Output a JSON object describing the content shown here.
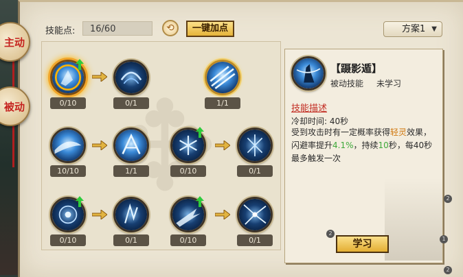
{
  "side_tabs": {
    "active": "主动",
    "passive": "被动"
  },
  "header": {
    "skill_points_label": "技能点:",
    "skill_points_value": "16/60",
    "one_key_button": "一键加点",
    "plan_select_value": "方案1"
  },
  "tree": {
    "skills": [
      {
        "level": "0/10"
      },
      {
        "level": "0/1"
      },
      {
        "level": "1/1"
      },
      {
        "level": "10/10"
      },
      {
        "level": "1/1"
      },
      {
        "level": "0/10"
      },
      {
        "level": "0/1"
      },
      {
        "level": "0/10"
      },
      {
        "level": "0/1"
      },
      {
        "level": "0/10"
      },
      {
        "level": "0/1"
      }
    ]
  },
  "detail": {
    "name": "【蹑影遁】",
    "type": "被动技能",
    "status": "未学习",
    "desc_title": "技能描述",
    "cooldown": "冷却时间: 40秒",
    "desc_part1": "受到攻击时有一定概率获得",
    "desc_em1": "轻灵",
    "desc_part2": "效果，闪避率提升",
    "desc_em2": "4.1%",
    "desc_part3": "，持续",
    "desc_em3": "10",
    "desc_part4": "秒，每40秒最多触发一次",
    "learn_button": "学习"
  },
  "badges": {
    "b1": "2",
    "b2": "2",
    "b3": "1",
    "b4": "2"
  },
  "colors": {
    "level_bg": "#5b5346",
    "accent_gold": "#e6b43a",
    "desc_red": "#c22c22",
    "green": "#3ea83a",
    "orange": "#d07a12"
  }
}
